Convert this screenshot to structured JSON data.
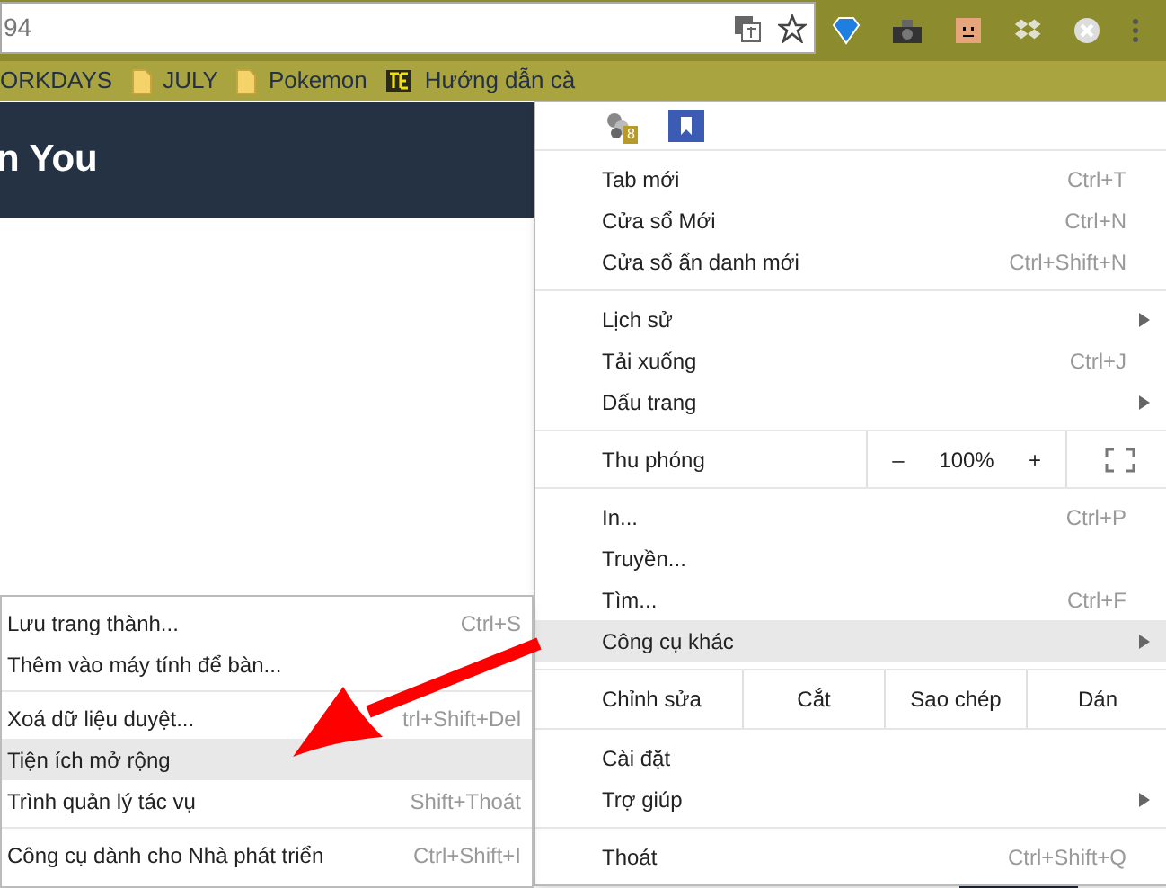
{
  "address_bar": {
    "value": "94"
  },
  "bookmarks": [
    {
      "label": "ORKDAYS",
      "kind": "text"
    },
    {
      "label": "JULY",
      "kind": "folder"
    },
    {
      "label": "Pokemon",
      "kind": "folder"
    },
    {
      "label": "Hướng dẫn cà",
      "kind": "site"
    }
  ],
  "page": {
    "heading": "n You"
  },
  "menu": {
    "extension_badge": "8",
    "groups": [
      {
        "kind": "items",
        "items": [
          {
            "label": "Tab mới",
            "shortcut": "Ctrl+T",
            "submenu": false,
            "selected": false
          },
          {
            "label": "Cửa sổ Mới",
            "shortcut": "Ctrl+N",
            "submenu": false,
            "selected": false
          },
          {
            "label": "Cửa sổ ẩn danh mới",
            "shortcut": "Ctrl+Shift+N",
            "submenu": false,
            "selected": false
          }
        ]
      },
      {
        "kind": "items",
        "items": [
          {
            "label": "Lịch sử",
            "submenu": true,
            "selected": false
          },
          {
            "label": "Tải xuống",
            "shortcut": "Ctrl+J",
            "submenu": false,
            "selected": false
          },
          {
            "label": "Dấu trang",
            "submenu": true,
            "selected": false
          }
        ]
      },
      {
        "kind": "zoom",
        "label": "Thu phóng",
        "minus": "–",
        "value": "100%",
        "plus": "+"
      },
      {
        "kind": "items",
        "items": [
          {
            "label": "In...",
            "shortcut": "Ctrl+P",
            "submenu": false,
            "selected": false
          },
          {
            "label": "Truyền...",
            "submenu": false,
            "selected": false
          },
          {
            "label": "Tìm...",
            "shortcut": "Ctrl+F",
            "submenu": false,
            "selected": false
          },
          {
            "label": "Công cụ khác",
            "submenu": true,
            "selected": true
          }
        ]
      },
      {
        "kind": "edit",
        "label": "Chỉnh sửa",
        "buttons": [
          "Cắt",
          "Sao chép",
          "Dán"
        ]
      },
      {
        "kind": "items",
        "items": [
          {
            "label": "Cài đặt",
            "submenu": false,
            "selected": false
          },
          {
            "label": "Trợ giúp",
            "submenu": true,
            "selected": false
          }
        ]
      },
      {
        "kind": "items",
        "items": [
          {
            "label": "Thoát",
            "shortcut": "Ctrl+Shift+Q",
            "submenu": false,
            "selected": false
          }
        ]
      }
    ]
  },
  "submenu": {
    "groups": [
      [
        {
          "label": "Lưu trang thành...",
          "shortcut": "Ctrl+S",
          "selected": false
        },
        {
          "label": "Thêm vào máy tính để bàn...",
          "selected": false
        }
      ],
      [
        {
          "label": "Xoá dữ liệu duyệt...",
          "shortcut": "trl+Shift+Del",
          "selected": false
        },
        {
          "label": "Tiện ích mở rộng",
          "selected": true
        },
        {
          "label": "Trình quản lý tác vụ",
          "shortcut": "Shift+Thoát",
          "selected": false
        }
      ],
      [
        {
          "label": "Công cụ dành cho Nhà phát triển",
          "shortcut": "Ctrl+Shift+I",
          "selected": false
        }
      ]
    ]
  }
}
